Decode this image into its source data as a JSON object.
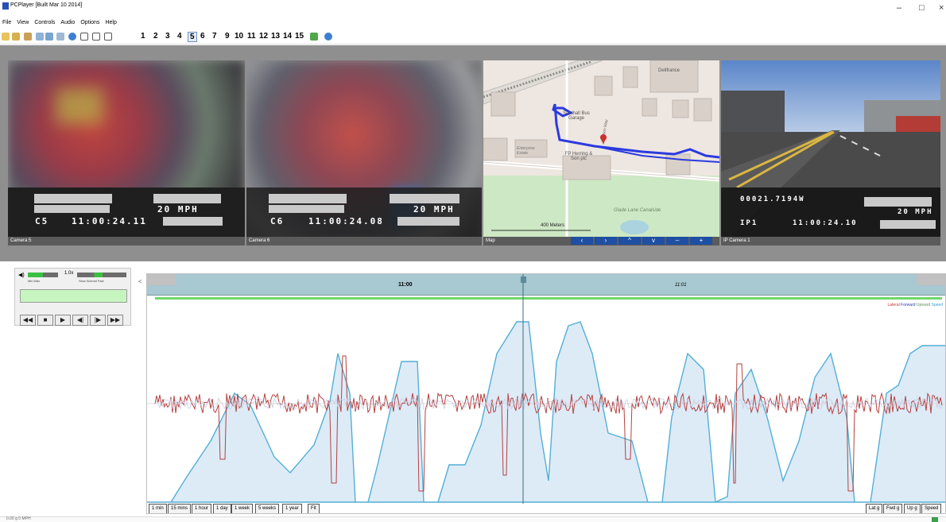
{
  "window": {
    "title": "PCPlayer [Built Mar 10 2014]",
    "minimize_glyph": "–",
    "maximize_glyph": "□",
    "close_glyph": "×"
  },
  "menu": {
    "items": [
      "File",
      "View",
      "Controls",
      "Audio",
      "Options",
      "Help"
    ]
  },
  "toolbar": {
    "icons": [
      "open-folder-icon",
      "save-icon",
      "export-icon",
      "copy-icon",
      "paste-icon",
      "print-icon",
      "globe-icon",
      "single-layout-icon",
      "dual-layout-icon",
      "grid-layout-icon"
    ],
    "layout_numbers": [
      "1",
      "2",
      "3",
      "4",
      "5",
      "6",
      "7",
      "9",
      "10",
      "11",
      "12",
      "13",
      "14",
      "15"
    ],
    "selected_layout": "5",
    "extra_icons": [
      "green-marker-icon",
      "globe-alt-icon"
    ]
  },
  "panels": [
    {
      "caption": "Camera 5",
      "osd_speed": "20 MPH",
      "osd_cam": "C5",
      "osd_time": "11:00:24.11"
    },
    {
      "caption": "Camera 6",
      "osd_speed": "20 MPH",
      "osd_cam": "C6",
      "osd_time": "11:00:24.08"
    },
    {
      "caption": "Map",
      "labels": {
        "delfrance": "Delifrance",
        "garage": "Southall Bus Garage",
        "enterprise": "Enterprise Estate",
        "herring": "FP Herring & Son plc",
        "glade": "Glade Lane Canalside",
        "jackson": "Jackson Way",
        "scale": "400 Meters"
      },
      "nav_buttons": [
        "‹",
        "›",
        "^",
        "v",
        "–",
        "+"
      ]
    },
    {
      "caption": "IP Camera 1",
      "osd_coord": "00021.7194W",
      "osd_speed": "20 MPH",
      "osd_cam": "IP1",
      "osd_time": "11:00:24.10"
    }
  ],
  "playback": {
    "volume_label": "Min  Max",
    "speed_value": "1.0x",
    "speed_label": "Slow  Normal  Fast",
    "buttons": [
      "◀◀",
      "■",
      "▶",
      "◀|",
      "|▶",
      "▶▶"
    ]
  },
  "timeline": {
    "left_arrow": "<",
    "label_main": "11:00",
    "label_next": "11:01",
    "playhead_fraction": 0.47
  },
  "legend": {
    "items": [
      "Lateral",
      "Forward",
      "Upward",
      "Speed"
    ],
    "colors": [
      "#cc3333",
      "#2b3aa8",
      "#7aa27a",
      "#3aa0d0"
    ]
  },
  "zoom_tabs": [
    "1 min",
    "15 mins",
    "1 hour",
    "1 day",
    "1 week",
    "5 weeks",
    "1 year",
    "Fit"
  ],
  "channel_tabs": [
    "Lat g",
    "Fwd g",
    "Up g",
    "Speed"
  ],
  "status": {
    "left": "0.00 g  0 MPH"
  },
  "colors": {
    "speed_fill": "#ddebf7",
    "speed_line": "#52afd6",
    "accel_line": "#b5413f",
    "green_bar": "#6fd86a",
    "timeline_bg": "#a8c8d2"
  }
}
